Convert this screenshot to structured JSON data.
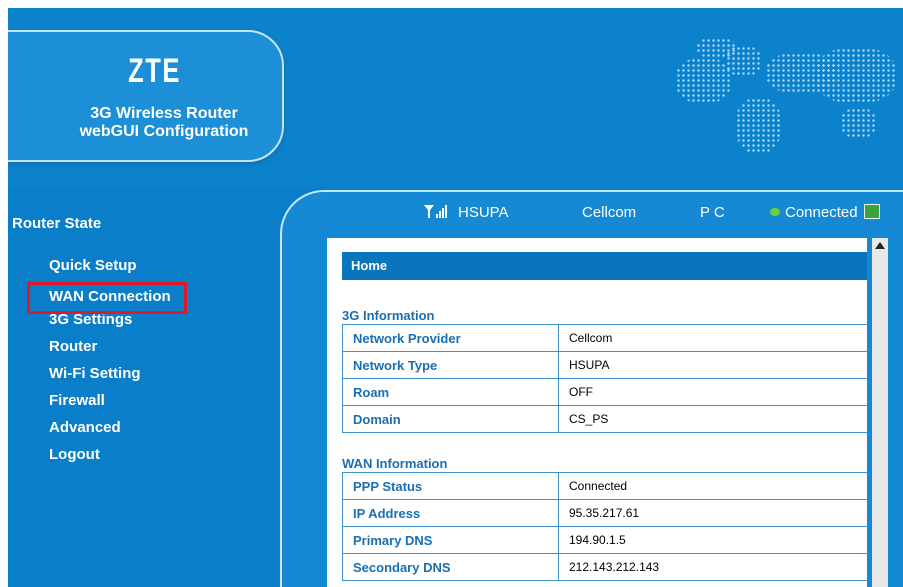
{
  "header": {
    "logo": "ZTE",
    "subtitle_line1": "3G Wireless Router",
    "subtitle_line2": "webGUI Configuration"
  },
  "sidebar": {
    "title": "Router State",
    "items": [
      {
        "label": "Quick Setup"
      },
      {
        "label": "WAN Connection",
        "highlighted": true
      },
      {
        "label": "3G Settings"
      },
      {
        "label": "Router"
      },
      {
        "label": "Wi-Fi Setting"
      },
      {
        "label": "Firewall"
      },
      {
        "label": "Advanced"
      },
      {
        "label": "Logout"
      }
    ]
  },
  "status": {
    "network_mode": "HSUPA",
    "provider": "Cellcom",
    "pc_label": "P C",
    "connection": "Connected"
  },
  "main": {
    "page_title": "Home",
    "sections": [
      {
        "title": "3G Information",
        "rows": [
          {
            "label": "Network Provider",
            "value": "Cellcom"
          },
          {
            "label": "Network Type",
            "value": "HSUPA"
          },
          {
            "label": "Roam",
            "value": "OFF"
          },
          {
            "label": "Domain",
            "value": "CS_PS"
          }
        ]
      },
      {
        "title": "WAN Information",
        "rows": [
          {
            "label": "PPP Status",
            "value": "Connected"
          },
          {
            "label": "IP Address",
            "value": "95.35.217.61"
          },
          {
            "label": "Primary DNS",
            "value": "194.90.1.5"
          },
          {
            "label": "Secondary DNS",
            "value": "212.143.212.143"
          }
        ]
      }
    ]
  },
  "colors": {
    "background": "#0a7ec9",
    "home_bar": "#0a74bd",
    "label_text": "#1a6fb3",
    "highlight_border": "#e0182a",
    "connected_dot": "#6bd13b"
  },
  "icons": {
    "signal": "signal-strength-icon",
    "connection": "connected-dot-icon",
    "map": "map-icon"
  }
}
